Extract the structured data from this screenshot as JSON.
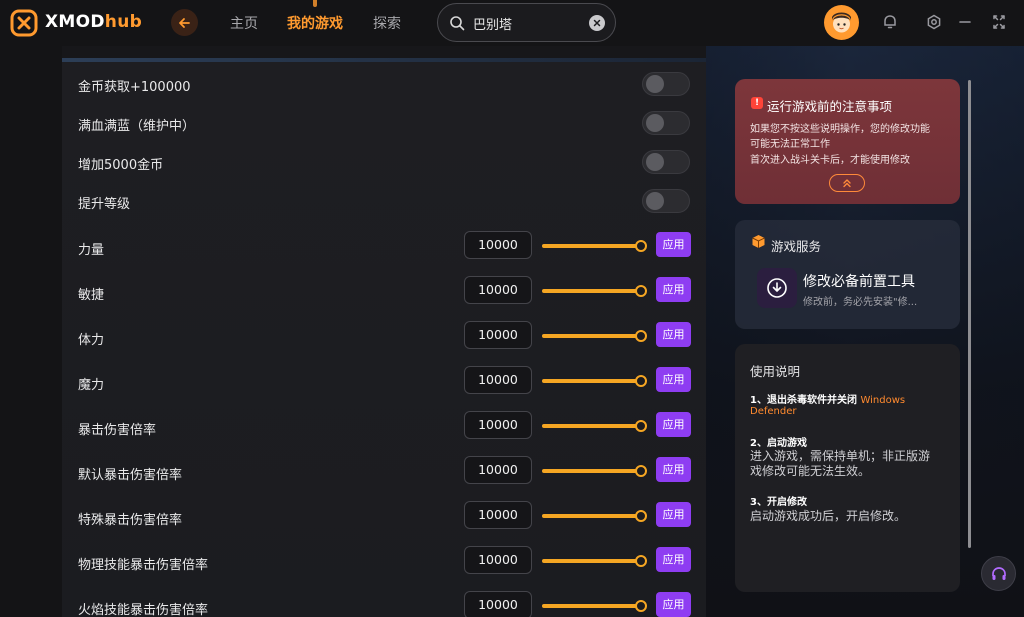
{
  "app": {
    "brand_main": "XMOD",
    "brand_accent": "hub",
    "accent_color": "#ff9a2f"
  },
  "nav": {
    "items": [
      {
        "label": "主页",
        "active": false
      },
      {
        "label": "我的游戏",
        "active": true
      },
      {
        "label": "探索",
        "active": false
      }
    ]
  },
  "search": {
    "value": "巴别塔",
    "icon": "search-icon"
  },
  "toggles": [
    {
      "label": "金币获取+100000",
      "on": false
    },
    {
      "label": "满血满蓝（维护中）",
      "on": false
    },
    {
      "label": "增加5000金币",
      "on": false
    },
    {
      "label": "提升等级",
      "on": false
    }
  ],
  "sliders": [
    {
      "label": "力量",
      "value": "10000"
    },
    {
      "label": "敏捷",
      "value": "10000"
    },
    {
      "label": "体力",
      "value": "10000"
    },
    {
      "label": "魔力",
      "value": "10000"
    },
    {
      "label": "暴击伤害倍率",
      "value": "10000"
    },
    {
      "label": "默认暴击伤害倍率",
      "value": "10000"
    },
    {
      "label": "特殊暴击伤害倍率",
      "value": "10000"
    },
    {
      "label": "物理技能暴击伤害倍率",
      "value": "10000"
    },
    {
      "label": "火焰技能暴击伤害倍率",
      "value": "10000"
    }
  ],
  "apply_label": "应用",
  "notice": {
    "title": "运行游戏前的注意事项",
    "lines": [
      "如果您不按这些说明操作，您的修改功能",
      "可能无法正常工作",
      "首次进入战斗关卡后，才能使用修改"
    ]
  },
  "service": {
    "title": "游戏服务",
    "tool_name": "修改必备前置工具",
    "tool_desc": "修改前，务必先安装\"修..."
  },
  "guide": {
    "title": "使用说明",
    "step1_title": "1、退出杀毒软件并关闭",
    "step1_highlight": "Windows",
    "step1_highlight2": "Defender",
    "step2_title": "2、启动游戏",
    "step2_line1": "进入游戏，需保持单机；非正版游",
    "step2_line2": "戏修改可能无法生效。",
    "step3_title": "3、开启修改",
    "step3_line1": "启动游戏成功后，开启修改。"
  }
}
